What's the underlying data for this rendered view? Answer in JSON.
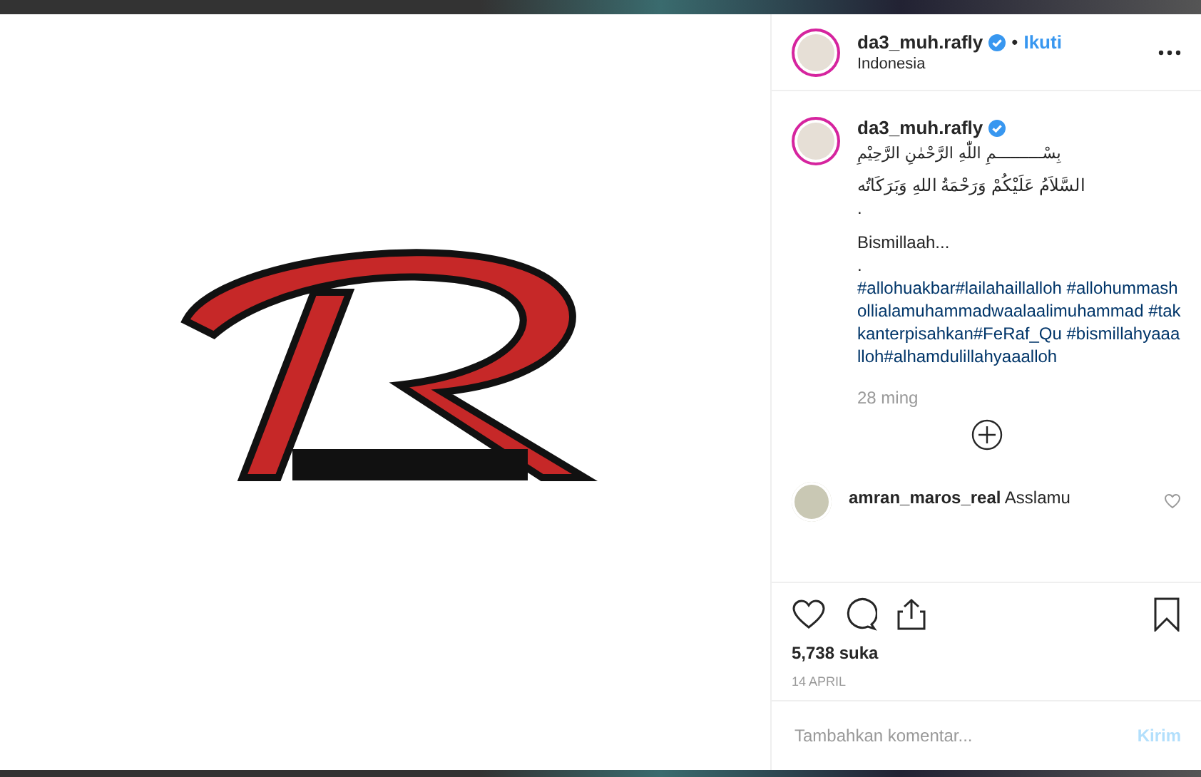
{
  "header": {
    "username": "da3_muh.rafly",
    "verified": true,
    "separator": "•",
    "follow": "Ikuti",
    "location": "Indonesia"
  },
  "caption": {
    "username": "da3_muh.rafly",
    "verified": true,
    "title": "بِسْــــــــــمِ اللّٰهِ الرَّحْمٰنِ الرَّحِيْمِ",
    "lines": [
      {
        "kind": "text",
        "text": "السَّلاَمُ عَلَيْكُمْ وَرَحْمَةُ اللهِ وَبَرَكَاتُه"
      },
      {
        "kind": "text",
        "text": "."
      },
      {
        "kind": "text",
        "text": "Bismillaah..."
      },
      {
        "kind": "text",
        "text": "."
      },
      {
        "kind": "tags",
        "text": "#allohuakbar#lailahaillalloh #allohummashollialamuhammadwaalaalimuhammad #takkanterpisahkan#FeRaf_Qu #bismillahyaaalloh#alhamdulillahyaaalloh"
      }
    ],
    "time": "28 ming"
  },
  "comments": [
    {
      "username": "amran_maros_real",
      "text": "Asslamu",
      "liked": false
    }
  ],
  "likes": "5,738 suka",
  "date": "14 APRIL",
  "comment_field": {
    "placeholder": "Tambahkan komentar...",
    "submit": "Kirim"
  }
}
